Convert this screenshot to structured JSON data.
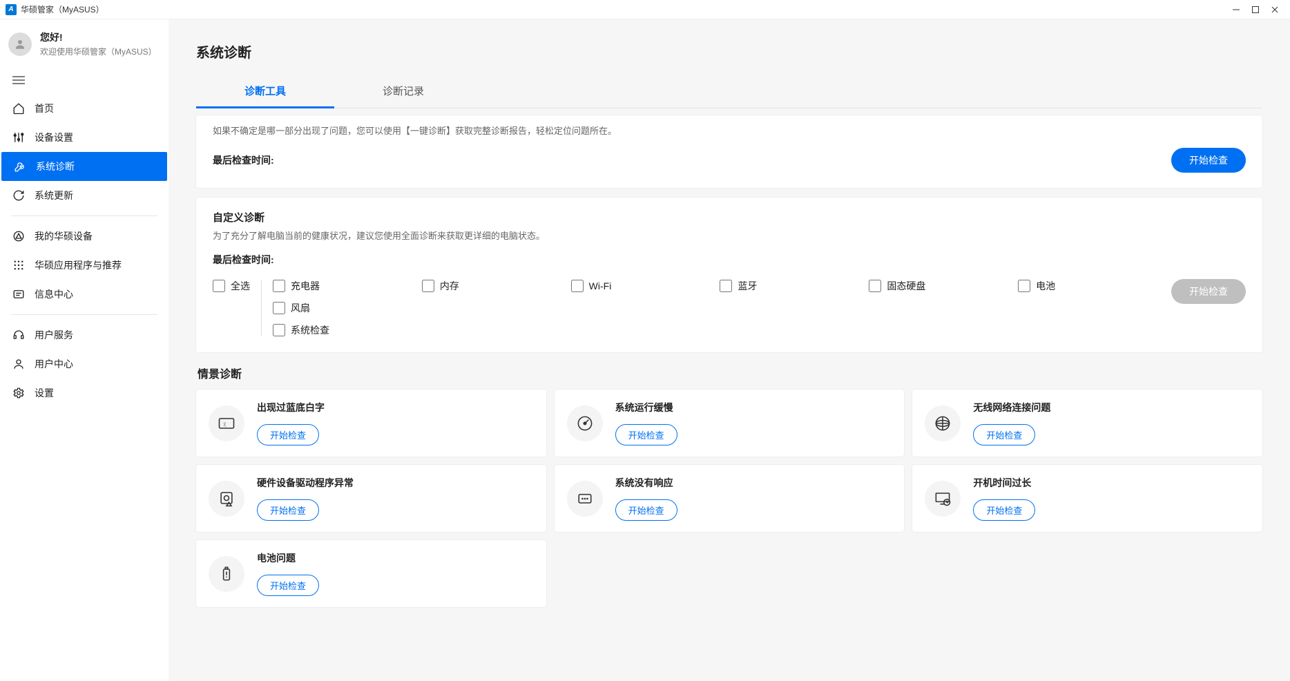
{
  "titlebar": {
    "app_name": "华硕管家（MyASUS）"
  },
  "user": {
    "hello": "您好!",
    "welcome": "欢迎使用华硕管家（MyASUS）"
  },
  "nav": {
    "home": "首页",
    "device": "设备设置",
    "diagnosis": "系统诊断",
    "update": "系统更新",
    "my_devices": "我的华硕设备",
    "apps": "华硕应用程序与推荐",
    "messages": "信息中心",
    "service": "用户服务",
    "user_center": "用户中心",
    "settings": "设置"
  },
  "page": {
    "title": "系统诊断",
    "tab_tool": "诊断工具",
    "tab_record": "诊断记录"
  },
  "oneclick": {
    "desc": "如果不确定是哪一部分出现了问题，您可以使用【一键诊断】获取完整诊断报告，轻松定位问题所在。",
    "last_label": "最后检查时间:",
    "start": "开始检查"
  },
  "custom": {
    "title": "自定义诊断",
    "desc": "为了充分了解电脑当前的健康状况，建议您使用全面诊断来获取更详细的电脑状态。",
    "last_label": "最后检查时间:",
    "select_all": "全选",
    "items": {
      "charger": "充电器",
      "memory": "内存",
      "wifi": "Wi-Fi",
      "bluetooth": "蓝牙",
      "ssd": "固态硬盘",
      "battery": "电池",
      "fan": "风扇",
      "syscheck": "系统检查"
    },
    "start": "开始检查"
  },
  "scenario": {
    "title": "情景诊断",
    "start": "开始检查",
    "cards": {
      "bsod": "出现过蓝底白字",
      "slow": "系统运行缓慢",
      "wifi": "无线网络连接问题",
      "driver": "硬件设备驱动程序异常",
      "hang": "系统没有响应",
      "boot": "开机时间过长",
      "battery": "电池问题"
    }
  }
}
